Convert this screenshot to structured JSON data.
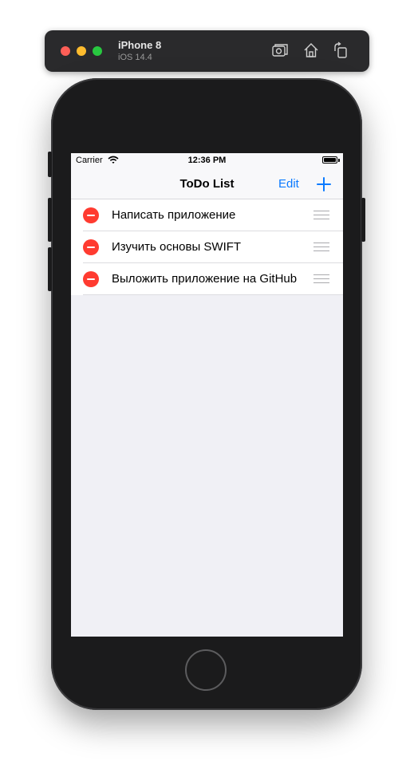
{
  "simulator": {
    "device_name": "iPhone 8",
    "os_version": "iOS 14.4",
    "icons": [
      "screenshot-icon",
      "home-icon",
      "rotate-icon"
    ]
  },
  "statusbar": {
    "carrier": "Carrier",
    "time": "12:36 PM"
  },
  "navbar": {
    "title": "ToDo List",
    "edit_label": "Edit",
    "add_icon": "plus-icon"
  },
  "tasks": [
    {
      "title": "Написать приложение"
    },
    {
      "title": "Изучить основы SWIFT"
    },
    {
      "title": "Выложить приложение на GitHub"
    }
  ],
  "colors": {
    "accent": "#0a7aff",
    "delete": "#ff3b30",
    "background": "#f0f0f5"
  }
}
